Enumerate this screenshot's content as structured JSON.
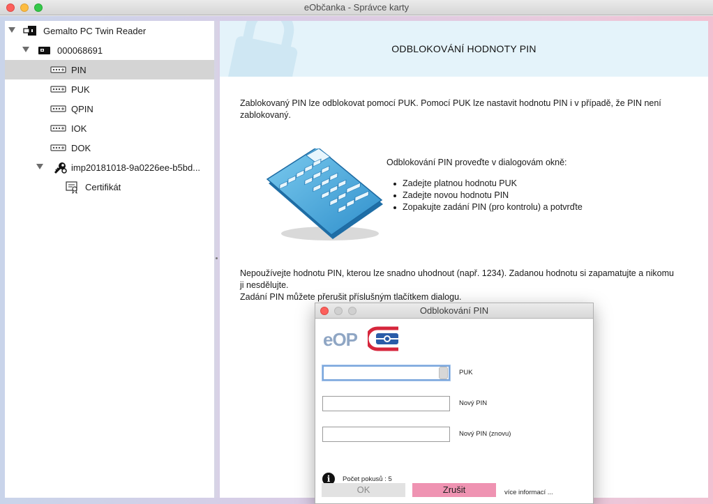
{
  "window": {
    "title": "eObčanka - Správce karty"
  },
  "sidebar": {
    "reader": {
      "label": "Gemalto PC Twin Reader",
      "icon": "card-reader-icon"
    },
    "card": {
      "label": "000068691",
      "icon": "chip-card-icon"
    },
    "items": [
      {
        "label": "PIN",
        "icon": "pin-keypad-icon",
        "selected": true
      },
      {
        "label": "PUK",
        "icon": "pin-keypad-icon"
      },
      {
        "label": "QPIN",
        "icon": "pin-keypad-icon"
      },
      {
        "label": "IOK",
        "icon": "pin-keypad-icon"
      },
      {
        "label": "DOK",
        "icon": "pin-keypad-icon"
      }
    ],
    "key": {
      "label": "imp20181018-9a0226ee-b5bd...",
      "icon": "key-icon"
    },
    "certificate": {
      "label": "Certifikát",
      "icon": "certificate-icon"
    }
  },
  "content": {
    "heading": "ODBLOKOVÁNÍ HODNOTY PIN",
    "intro_line1": "Zablokovaný PIN lze odblokovat pomocí PUK. Pomocí PUK lze nastavit hodnotu PIN i v případě, že PIN není",
    "intro_line2": "zablokovaný.",
    "instruction": "Odblokování PIN proveďte v dialogovám okně:",
    "steps": [
      "Zadejte platnou hodnotu PUK",
      "Zadejte novou hodnotu PIN",
      "Zopakujte zadání PIN (pro kontrolu) a potvrďte"
    ],
    "warning_line1": "Nepoužívejte hodnotu PIN, kterou lze snadno uhodnout (např. 1234). Zadanou hodnotu si zapamatujte a nikomu",
    "warning_line2": "ji nesdělujte.",
    "warning_line3": "Zadání PIN můžete přerušit příslušným tlačítkem dialogu."
  },
  "dialog": {
    "title": "Odblokování PIN",
    "logo_text": "eOP",
    "fields": [
      {
        "label": "PUK",
        "value": "",
        "focused": true
      },
      {
        "label": "Nový PIN",
        "value": ""
      },
      {
        "label": "Nový PIN (znovu)",
        "value": ""
      }
    ],
    "attempts": "Počet pokusů : 5",
    "ok_label": "OK",
    "cancel_label": "Zrušit",
    "more_info": "více informací ..."
  },
  "colors": {
    "banner_bg": "#e4f3fa",
    "cancel_button": "#ef93b2",
    "logo_blue": "#8fa6c4",
    "logo_red": "#d6263c",
    "selection": "#d4d4d4"
  }
}
